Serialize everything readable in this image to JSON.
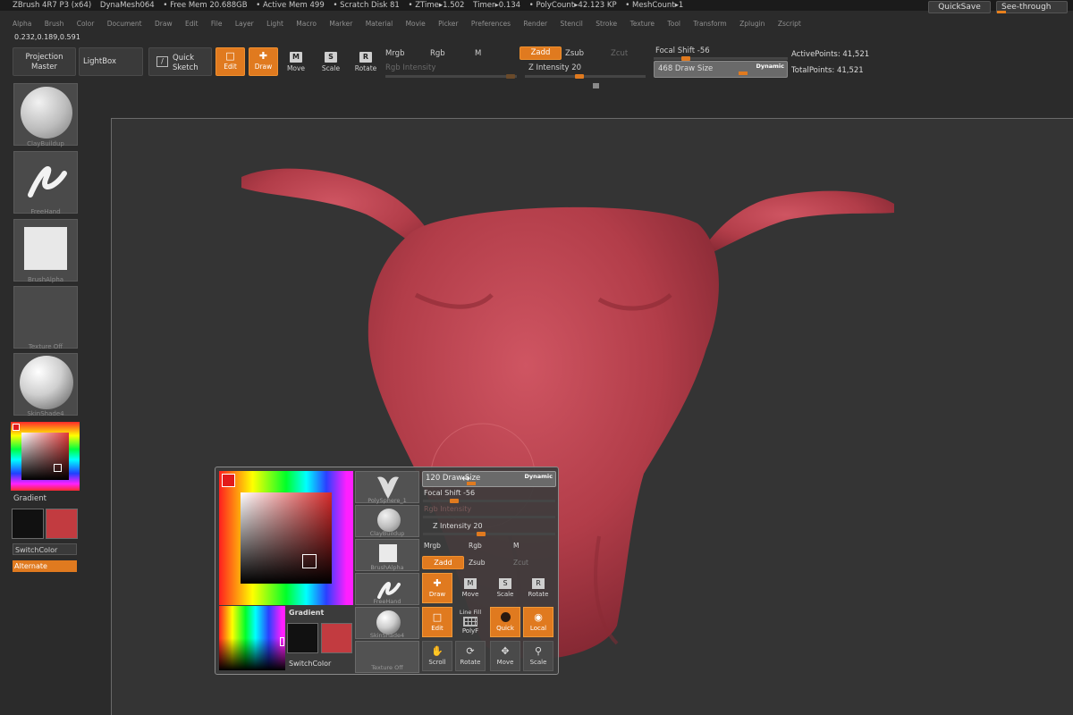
{
  "status": {
    "app": "ZBrush 4R7 P3 (x64)",
    "doc": "DynaMesh064",
    "free_mem": "• Free Mem 20.688GB",
    "active_mem": "• Active Mem 499",
    "scratch": "• Scratch Disk 81",
    "ztime": "• ZTime▸1.502",
    "timer": "Timer▸0.134",
    "polycount": "• PolyCount▸42.123 KP",
    "meshcount": "• MeshCount▸1",
    "quicksave": "QuickSave",
    "seethrough": "See-through",
    "seethrough_value": "0"
  },
  "menu": [
    "Alpha",
    "Brush",
    "Color",
    "Document",
    "Draw",
    "Edit",
    "File",
    "Layer",
    "Light",
    "Macro",
    "Marker",
    "Material",
    "Movie",
    "Picker",
    "Preferences",
    "Render",
    "Stencil",
    "Stroke",
    "Texture",
    "Tool",
    "Transform",
    "Zplugin",
    "Zscript"
  ],
  "coords": "0.232,0.189,0.591",
  "toolbar": {
    "projection_master": "Projection\nMaster",
    "lightbox": "LightBox",
    "quick_sketch": "Quick\nSketch",
    "edit": "Edit",
    "draw": "Draw",
    "move": "Move",
    "scale": "Scale",
    "rotate": "Rotate",
    "mrgb": "Mrgb",
    "rgb": "Rgb",
    "m": "M",
    "rgb_intensity": "Rgb Intensity",
    "zadd": "Zadd",
    "zsub": "Zsub",
    "zcut": "Zcut",
    "z_intensity": "Z Intensity 20",
    "focal_shift": "Focal Shift -56",
    "draw_size": "468 Draw Size",
    "dynamic": "Dynamic",
    "active_points": "ActivePoints: 41,521",
    "total_points": "TotalPoints: 41,521"
  },
  "shelf": {
    "brush": "ClayBuildup",
    "stroke": "FreeHand",
    "alpha": "BrushAlpha",
    "texture": "Texture Off",
    "material": "SkinShade4",
    "gradient": "Gradient",
    "switchcolor": "SwitchColor",
    "alternate": "Alternate"
  },
  "colors": {
    "accent": "#e07a1f",
    "model": "#b8414d",
    "main_color": "#c23b40",
    "secondary_color": "#111111"
  },
  "popup": {
    "tool": "PolySphere_1",
    "brush": "ClayBuildup",
    "alpha": "BrushAlpha",
    "stroke": "FreeHand",
    "material": "SkinShade4",
    "texture": "Texture Off",
    "draw_size": "120 Draw Size",
    "dynamic": "Dynamic",
    "focal_shift": "Focal Shift -56",
    "rgb_intensity": "Rgb Intensity",
    "z_intensity": "Z Intensity 20",
    "mrgb": "Mrgb",
    "rgb": "Rgb",
    "m": "M",
    "zadd": "Zadd",
    "zsub": "Zsub",
    "zcut": "Zcut",
    "draw": "Draw",
    "move": "Move",
    "scale": "Scale",
    "rotate": "Rotate",
    "edit": "Edit",
    "line_fill": "Line Fill",
    "polyf": "PolyF",
    "quick": "Quick",
    "local": "Local",
    "scroll": "Scroll",
    "rotate2": "Rotate",
    "move2": "Move",
    "scale2": "Scale",
    "gradient": "Gradient",
    "switchcolor": "SwitchColor"
  }
}
